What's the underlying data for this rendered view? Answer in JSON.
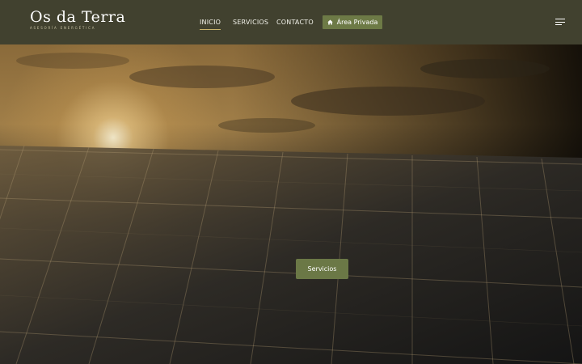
{
  "header": {
    "logo_title": "Os da Terra",
    "logo_tagline": "Asesoría Energética"
  },
  "nav": {
    "items": [
      {
        "label": "INICIO",
        "active": true
      },
      {
        "label": "SERVICIOS",
        "active": false
      },
      {
        "label": "CONTACTO",
        "active": false
      }
    ],
    "private_area": {
      "label": "Área Privada",
      "icon": "home-icon"
    },
    "menu_icon": "hamburger-menu-icon"
  },
  "hero": {
    "button_label": "Servicios"
  },
  "colors": {
    "header_bg": "#41412f",
    "accent_green": "#6d7a46",
    "active_underline": "#c9b36b"
  }
}
